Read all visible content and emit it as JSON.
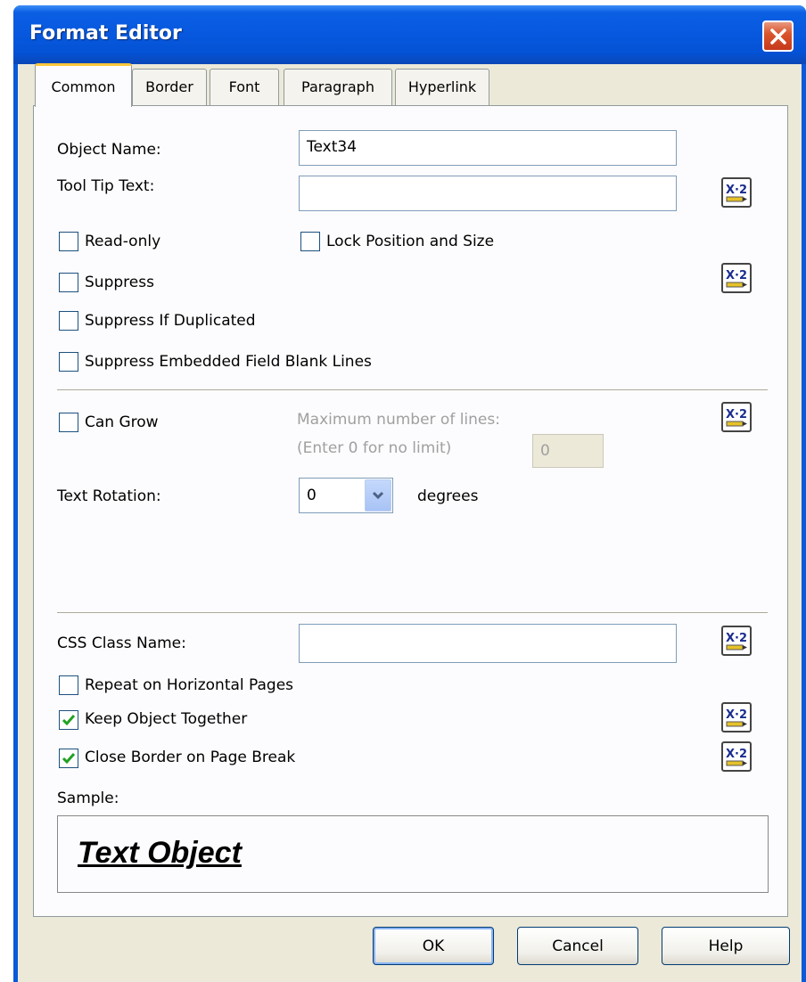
{
  "window": {
    "title": "Format Editor",
    "close_icon": "close-icon"
  },
  "tabs": [
    {
      "label": "Common",
      "active": true
    },
    {
      "label": "Border",
      "active": false
    },
    {
      "label": "Font",
      "active": false
    },
    {
      "label": "Paragraph",
      "active": false
    },
    {
      "label": "Hyperlink",
      "active": false
    }
  ],
  "common": {
    "object_name_label": "Object Name:",
    "object_name_value": "Text34",
    "tooltip_label": "Tool Tip Text:",
    "tooltip_value": "",
    "read_only": {
      "label": "Read-only",
      "checked": false
    },
    "lock_position": {
      "label": "Lock Position and Size",
      "checked": false
    },
    "suppress": {
      "label": "Suppress",
      "checked": false
    },
    "suppress_if_duplicated": {
      "label": "Suppress If Duplicated",
      "checked": false
    },
    "suppress_blank_lines": {
      "label": "Suppress Embedded Field Blank Lines",
      "checked": false
    },
    "can_grow": {
      "label": "Can Grow",
      "checked": false
    },
    "max_lines_label": "Maximum number of lines:",
    "max_lines_hint": "(Enter 0 for no limit)",
    "max_lines_value": "0",
    "text_rotation_label": "Text Rotation:",
    "text_rotation_value": "0",
    "degrees_label": "degrees",
    "css_class_label": "CSS Class Name:",
    "css_class_value": "",
    "repeat_horizontal": {
      "label": "Repeat on Horizontal Pages",
      "checked": false
    },
    "keep_together": {
      "label": "Keep Object Together",
      "checked": true
    },
    "close_border": {
      "label": "Close Border on Page Break",
      "checked": true
    },
    "sample_label": "Sample:",
    "sample_text": "Text Object"
  },
  "buttons": {
    "ok": "OK",
    "cancel": "Cancel",
    "help": "Help"
  },
  "colors": {
    "title_bar": "#0758de",
    "dialog_bg": "#ece9d8",
    "active_tab_accent": "#ffc83c",
    "check_mark": "#21a121"
  }
}
